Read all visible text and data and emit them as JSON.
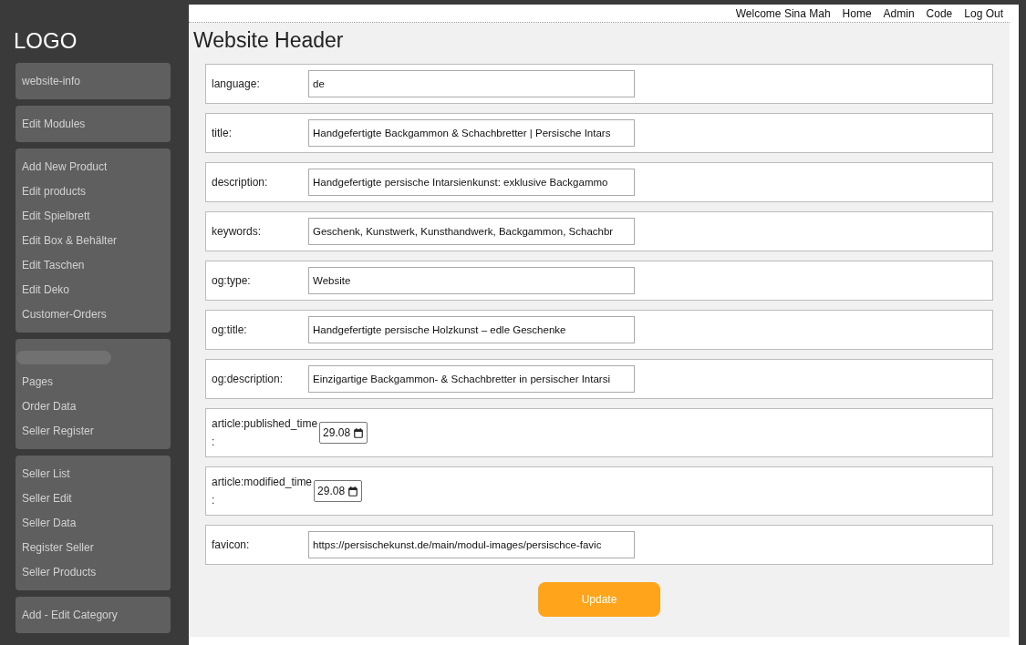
{
  "sidebar": {
    "logo": "LOGO",
    "groups": [
      {
        "items": [
          {
            "kind": "link",
            "label": "website-info"
          }
        ]
      },
      {
        "items": [
          {
            "kind": "link",
            "label": "Edit Modules"
          }
        ]
      },
      {
        "items": [
          {
            "kind": "link",
            "label": "Add New Product"
          },
          {
            "kind": "link",
            "label": "Edit products"
          },
          {
            "kind": "link",
            "label": "Edit Spielbrett"
          },
          {
            "kind": "link",
            "label": "Edit Box & Behälter"
          },
          {
            "kind": "link",
            "label": "Edit Taschen"
          },
          {
            "kind": "link",
            "label": "Edit Deko"
          },
          {
            "kind": "link",
            "label": "Customer-Orders"
          }
        ]
      },
      {
        "items": [
          {
            "kind": "redacted"
          },
          {
            "kind": "link",
            "label": "Pages"
          },
          {
            "kind": "link",
            "label": "Order Data"
          },
          {
            "kind": "link",
            "label": "Seller Register"
          }
        ]
      },
      {
        "items": [
          {
            "kind": "link",
            "label": "Seller List"
          },
          {
            "kind": "link",
            "label": "Seller Edit"
          },
          {
            "kind": "link",
            "label": "Seller Data"
          },
          {
            "kind": "link",
            "label": "Register Seller"
          },
          {
            "kind": "link",
            "label": "Seller Products"
          }
        ]
      },
      {
        "items": [
          {
            "kind": "link",
            "label": "Add - Edit Category"
          }
        ]
      }
    ]
  },
  "top_nav": {
    "welcome": "Welcome Sina Mah",
    "links": [
      "Home",
      "Admin",
      "Code",
      "Log Out"
    ]
  },
  "page_title": "Website Header",
  "fields": [
    {
      "kind": "text",
      "label": "language:",
      "value": "de"
    },
    {
      "kind": "text",
      "label": "title:",
      "value": "Handgefertigte Backgammon & Schachbretter | Persische Intars"
    },
    {
      "kind": "text",
      "label": "description:",
      "value": "Handgefertigte persische Intarsienkunst: exklusive Backgammo"
    },
    {
      "kind": "text",
      "label": "keywords:",
      "value": "Geschenk, Kunstwerk, Kunsthandwerk, Backgammon, Schachbr"
    },
    {
      "kind": "text",
      "label": "og:type:",
      "value": "Website"
    },
    {
      "kind": "text",
      "label": "og:title:",
      "value": "Handgefertigte persische Holzkunst – edle Geschenke"
    },
    {
      "kind": "text",
      "label": "og:description:",
      "value": "Einzigartige Backgammon- & Schachbretter in persischer Intarsi"
    },
    {
      "kind": "date",
      "label": "article:published_time :",
      "value": "29.08"
    },
    {
      "kind": "date",
      "label": "article:modified_time :",
      "value": "29.08"
    },
    {
      "kind": "text",
      "label": "favicon:",
      "value": "https://persischekunst.de/main/modul-images/persischce-favic"
    }
  ],
  "submit_button": "Update"
}
